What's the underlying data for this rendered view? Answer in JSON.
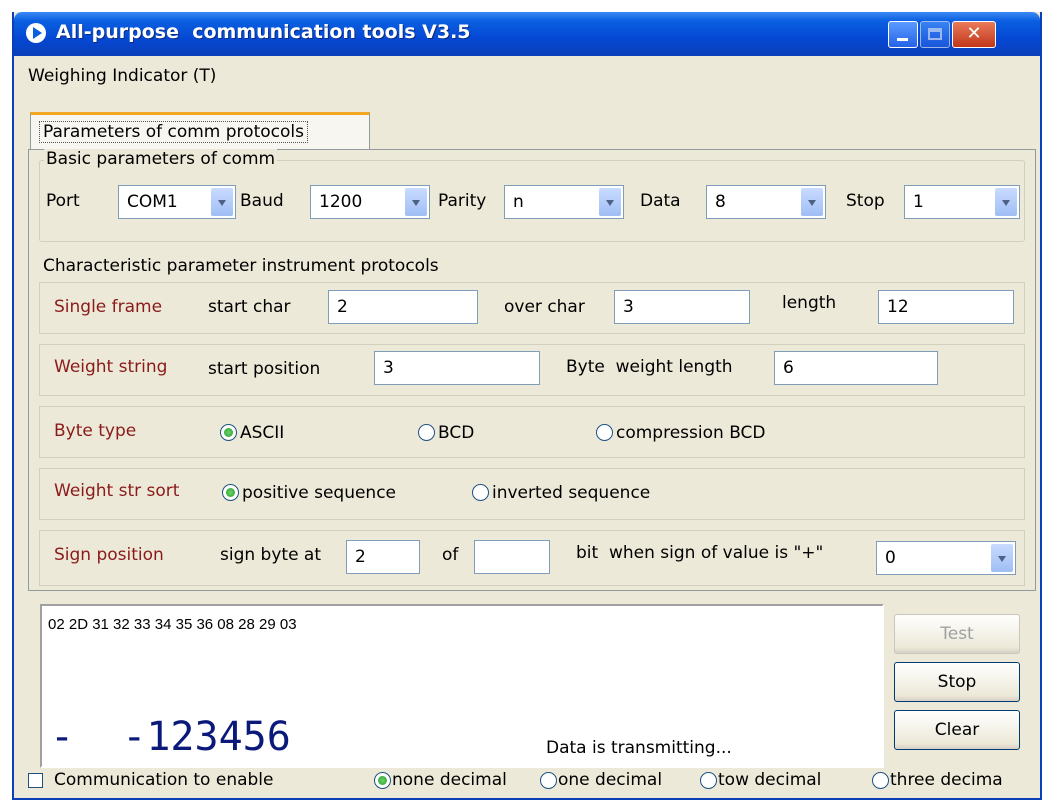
{
  "window": {
    "title": "All-purpose  communication tools V3.5",
    "close_glyph": "✕"
  },
  "menu": {
    "weighing_indicator": "Weighing Indicator (T)"
  },
  "tab": {
    "label": "Parameters of comm protocols"
  },
  "basic": {
    "legend": "Basic parameters of comm",
    "port_label": "Port",
    "port_value": "COM1",
    "baud_label": "Baud",
    "baud_value": "1200",
    "parity_label": "Parity",
    "parity_value": "n",
    "data_label": "Data",
    "data_value": "8",
    "stop_label": "Stop",
    "stop_value": "1"
  },
  "characteristic": {
    "legend": "Characteristic parameter instrument  protocols",
    "single_frame": {
      "label": "Single frame",
      "start_char_label": "start char",
      "start_char_value": "2",
      "over_char_label": "over char",
      "over_char_value": "3",
      "length_label": "length",
      "length_value": "12"
    },
    "weight_string": {
      "label": "Weight string",
      "start_position_label": "start position",
      "start_position_value": "3",
      "weight_length_label": "Byte  weight length",
      "weight_length_value": "6"
    },
    "byte_type": {
      "label": "Byte type",
      "options": [
        "ASCII",
        "BCD",
        "compression BCD"
      ],
      "selected": "ASCII"
    },
    "weight_str_sort": {
      "label": "Weight str sort",
      "options": [
        "positive sequence",
        "inverted sequence"
      ],
      "selected": "positive sequence"
    },
    "sign_position": {
      "label": "Sign position",
      "sign_byte_label": "sign byte at",
      "sign_byte_value": "2",
      "of_label": "of",
      "of_value": "",
      "bit_label": "bit  when sign of value is \"+\"",
      "plus_value": "0"
    }
  },
  "output": {
    "hex": "02 2D 31 32 33 34 35 36 08 28 29 03",
    "weight_display": "-  -123456",
    "status": "Data is transmitting..."
  },
  "buttons": {
    "test": "Test",
    "stop": "Stop",
    "clear": "Clear"
  },
  "footer": {
    "enable_label": "Communication to enable",
    "decimals": [
      "none decimal",
      "one decimal",
      "tow decimal",
      "three decima"
    ],
    "selected": "none decimal"
  },
  "colors": {
    "label_red": "#8b1a1a",
    "weight_blue": "#0b1a7a",
    "title_blue": "#0a5fe0"
  },
  "icons": [
    "app-play-icon",
    "minimize-icon",
    "maximize-icon",
    "close-icon",
    "dropdown-arrow-icon",
    "radio-icon",
    "checkbox-icon"
  ]
}
